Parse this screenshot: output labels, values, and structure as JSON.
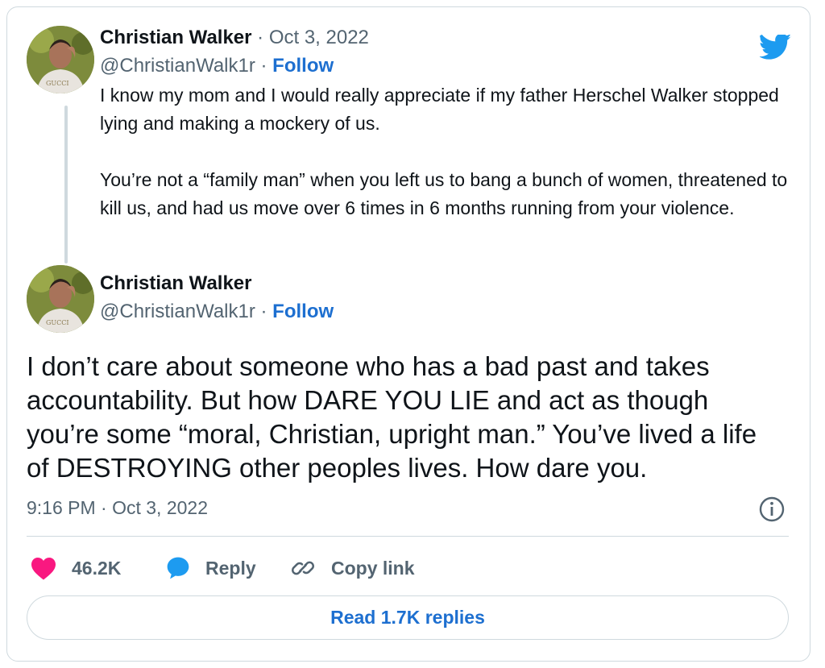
{
  "quoted_tweet": {
    "author_name": "Christian Walker",
    "separator": " · ",
    "date": "Oct 3, 2022",
    "handle": "@ChristianWalk1r",
    "follow_label": "Follow",
    "paragraph1": "I know my mom and I would really appreciate if my father Herschel Walker stopped lying and making a mockery of us.",
    "paragraph2": "You’re not a “family man” when you left us to bang a bunch of women, threatened to kill us, and had us move over 6 times in 6 months running from your violence."
  },
  "main_tweet": {
    "author_name": "Christian Walker",
    "handle": "@ChristianWalk1r",
    "separator": " · ",
    "follow_label": "Follow",
    "text": "I don’t care about someone who has a bad past and takes accountability. But how DARE YOU LIE and act as though you’re some “moral, Christian, upright man.” You’ve lived a life of DESTROYING other peoples lives.  How dare you.",
    "timestamp": "9:16 PM · Oct 3, 2022"
  },
  "actions": {
    "likes_count": "46.2K",
    "reply_label": "Reply",
    "copy_link_label": "Copy link"
  },
  "read_replies_label": "Read 1.7K replies",
  "icons": {
    "brand": "twitter-bird-icon",
    "like": "heart-icon",
    "reply": "speech-bubble-icon",
    "copy": "link-icon",
    "info": "info-icon"
  },
  "colors": {
    "heart": "#f91880",
    "brand_blue": "#1d9bf0",
    "link_blue": "#1d6fd0",
    "muted_text": "#536471"
  }
}
